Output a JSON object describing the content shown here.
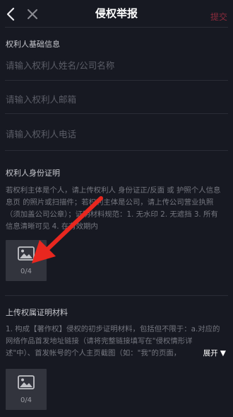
{
  "header": {
    "title": "侵权举报",
    "submit_label": "提交"
  },
  "basic_info": {
    "title": "权利人基础信息",
    "name_placeholder": "请输入权利人姓名/公司名称",
    "email_placeholder": "请输入权利人邮箱",
    "phone_placeholder": "请输入权利人电话"
  },
  "identity": {
    "title": "权利人身份证明",
    "lines": [
      "若权利主体是个人，请上传权利人 身份证正/反面 或 护照个人信息",
      "息页 的照片或扫描件；若权利主体是公司，请上传公司营业执照",
      "（须加盖公司公章）；证明材料规范：1. 无水印 2. 无遮挡 3. 所有",
      "信息清晰可见 4. 在有效期内"
    ],
    "upload_count": "0/4"
  },
  "ownership": {
    "title": "上传权属证明材料",
    "lines": [
      "1. 构成【著作权】侵权的初步证明材料，包括但不限于：a.对应的",
      "网络作品首发地址链接（请将完整链接填写在\"侵权情形详",
      "述\"中）、首发帐号的个人主页截图（如：\"我\"的页面，"
    ],
    "expand_label": "展开",
    "upload_count": "0/4"
  }
}
